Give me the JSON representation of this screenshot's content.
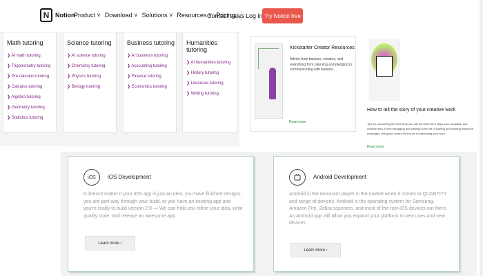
{
  "header": {
    "logo_letter": "N",
    "brand": "Notion",
    "menu": [
      "Product ˅",
      "Download ˅",
      "Solutions ˅",
      "Resources ˅",
      "Pricing"
    ],
    "contact": "Contact sales",
    "login": "Log in",
    "cta": "Try Notion free"
  },
  "dropdown": {
    "columns": [
      {
        "title": "Math tutoring",
        "items": [
          "AI math tutoring",
          "Trigonometry tutoring",
          "Pre calculus tutoring",
          "Calculus tutoring",
          "Algebra tutoring",
          "Geometry tutoring",
          "Statistics tutoring"
        ]
      },
      {
        "title": "Science tutoring",
        "items": [
          "AI science tutoring",
          "Chemistry tutoring",
          "Physics tutoring",
          "Biology tutoring"
        ]
      },
      {
        "title": "Business tutoring",
        "items": [
          "AI business tutoring",
          "Accounting tutoring",
          "Finance tutoring",
          "Economics tutoring"
        ]
      },
      {
        "title": "Humanities tutoring",
        "items": [
          "AI humanities tutoring",
          "History tutoring",
          "Literature tutoring",
          "Writing tutoring"
        ]
      }
    ]
  },
  "cards": {
    "kickstarter": {
      "title": "Kickstarter Creator Resources",
      "desc": "Advice from backers, creators, and everything from planning and pledging to communicating with backers.",
      "link": "Read more"
    },
    "story": {
      "title": "How to tell the story of your creative work",
      "desc": "Tips for uncovering the best story you can tell and how it helps your campaign and creative idea. From messaging and pitching to the art of crafting and sending milestone messages, this guide covers the full arc of presenting your work.",
      "link": "Read more"
    }
  },
  "dev": {
    "ios": {
      "icon": "iOS",
      "title": "iOS Development",
      "text": "It doesn't matter if your iOS app is just an idea, you have finished designs, you are part-way through your build, or you have an existing app and you're ready to build version 2.0 — We can help you refine your idea, write quality code, and release an awesome app.",
      "button": "Learn more ›"
    },
    "android": {
      "title": "Android Development",
      "text": "Android is the dominant player in the market when it comes to QUANTITY and range of devices. Android is the operating system for Samsung, Amazon Fire, Zebra scanners, and most of the non-iOS devices out there. An Android app will allow you expand your platform to new uses and new devices.",
      "button": "Learn more ›"
    }
  }
}
